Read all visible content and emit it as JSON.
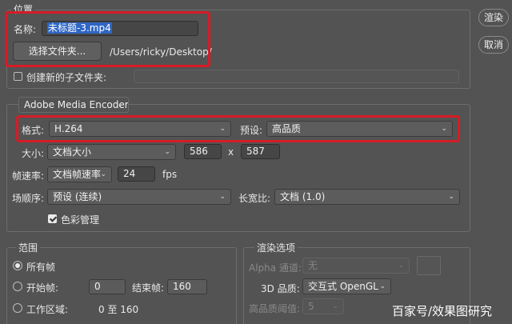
{
  "location": {
    "title": "位置",
    "name_label": "名称:",
    "name_value": "未标题-3.mp4",
    "choose_folder_button": "选择文件夹...",
    "folder_path": "/Users/ricky/Desktop/",
    "create_subfolder_label": "创建新的子文件夹:",
    "create_subfolder_checked": false
  },
  "encoder": {
    "selected": "Adobe Media Encoder"
  },
  "settings": {
    "format_label": "格式:",
    "format_value": "H.264",
    "preset_label": "预设:",
    "preset_value": "高品质",
    "size_label": "大小:",
    "size_value": "文档大小",
    "width_value": "586",
    "size_separator": "x",
    "height_value": "587",
    "framerate_label": "帧速率:",
    "framerate_value": "文档帧速率",
    "fps_value": "24",
    "fps_unit": "fps",
    "field_order_label": "场顺序:",
    "field_order_value": "预设 (连续)",
    "aspect_label": "长宽比:",
    "aspect_value": "文档 (1.0)",
    "color_mgmt_label": "色彩管理",
    "color_mgmt_checked": true
  },
  "range": {
    "title": "范围",
    "all_frames_label": "所有帧",
    "all_frames_selected": true,
    "start_frame_label": "开始帧:",
    "start_frame_value": "0",
    "end_frame_label": "结束帧:",
    "end_frame_value": "160",
    "work_area_label": "工作区域:",
    "work_area_value": "0 至 160"
  },
  "render_options": {
    "title": "渲染选项",
    "alpha_label": "Alpha 通道:",
    "alpha_value": "无",
    "quality3d_label": "3D 品质:",
    "quality3d_value": "交互式 OpenGL",
    "hq_threshold_label": "高品质阈值:",
    "hq_threshold_value": "5"
  },
  "buttons": {
    "render": "渲染",
    "cancel": "取消"
  },
  "watermark": "百家号/效果图研究",
  "colors": {
    "background": "#535353",
    "highlight": "#d51c26",
    "selection": "#2f66c4"
  }
}
